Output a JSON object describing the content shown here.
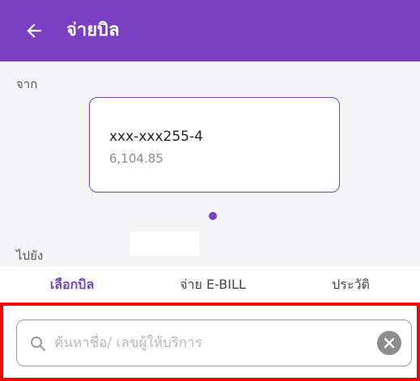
{
  "header": {
    "title": "จ่ายบิล",
    "back_icon": "arrow-left-icon",
    "background_color": "#7b3fc4"
  },
  "from_section": {
    "label": "จาก",
    "account": {
      "number": "xxx-xxx255-4",
      "balance": "6,104.85"
    }
  },
  "to_section": {
    "label": "ไปยัง"
  },
  "tabs": [
    {
      "label": "เลือกบิล",
      "active": true
    },
    {
      "label": "จ่าย E-BILL",
      "active": false
    },
    {
      "label": "ประวัติ",
      "active": false
    }
  ],
  "search": {
    "placeholder": "ค้นหาชื่อ/ เลขผู้ให้บริการ",
    "value": "",
    "search_icon": "search-icon",
    "clear_icon": "clear-icon"
  },
  "colors": {
    "accent": "#7b3fc4",
    "highlight": "#ff0000"
  }
}
